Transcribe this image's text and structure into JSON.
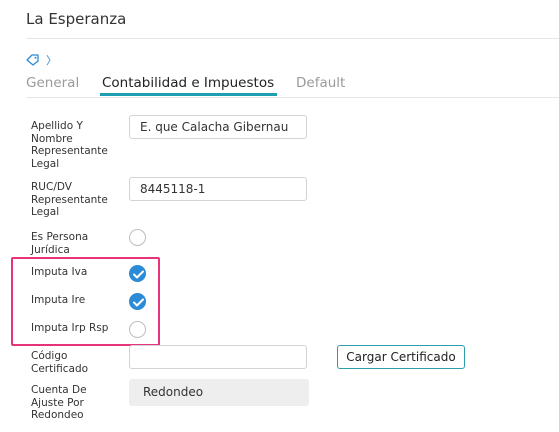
{
  "header": {
    "title": "La Esperanza"
  },
  "breadcrumb": {
    "separator": "〉"
  },
  "tabs": [
    {
      "label": "General",
      "active": false
    },
    {
      "label": "Contabilidad e Impuestos",
      "active": true
    },
    {
      "label": "Default",
      "active": false
    }
  ],
  "form": {
    "representante": {
      "label_lines": [
        "Apellido Y",
        "Nombre",
        "Representante",
        "Legal"
      ],
      "value": "E. que Calacha Gibernau"
    },
    "ruc": {
      "label_lines": [
        "RUC/DV",
        "Representante",
        "Legal"
      ],
      "value": "8445118-1"
    },
    "persona_juridica": {
      "label_lines": [
        "Es Persona",
        "Jurídica"
      ],
      "checked": false
    },
    "imputa_iva": {
      "label": "Imputa Iva",
      "checked": true
    },
    "imputa_ire": {
      "label": "Imputa Ire",
      "checked": true
    },
    "imputa_irp": {
      "label": "Imputa Irp Rsp",
      "checked": false
    },
    "certificado": {
      "label_lines": [
        "Código",
        "Certificado"
      ],
      "value": "",
      "button_label": "Cargar Certificado"
    },
    "cuenta_ajuste": {
      "label_lines": [
        "Cuenta De",
        "Ajuste Por",
        "Redondeo"
      ],
      "value": "Redondeo"
    }
  },
  "colors": {
    "accent": "#1d9fb2",
    "check": "#2b8bd6",
    "highlight": "#e8337a"
  }
}
